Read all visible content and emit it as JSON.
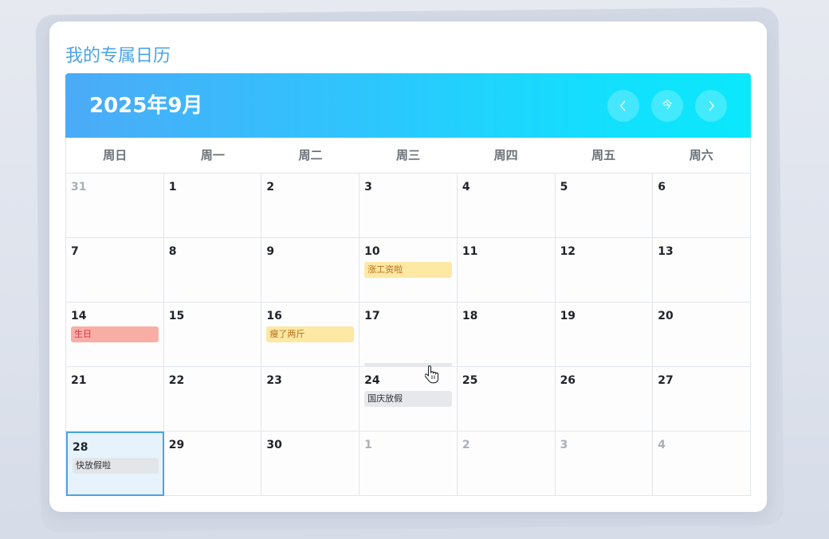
{
  "app": {
    "title": "我的专属日历"
  },
  "header": {
    "month_label": "2025年9月",
    "prev_button": "‹",
    "today_button": "今",
    "next_button": "›"
  },
  "weekdays": [
    "周日",
    "周一",
    "周二",
    "周三",
    "周四",
    "周五",
    "周六"
  ],
  "weeks": [
    [
      {
        "day": "31",
        "other_month": true
      },
      {
        "day": "1"
      },
      {
        "day": "2"
      },
      {
        "day": "3"
      },
      {
        "day": "4"
      },
      {
        "day": "5"
      },
      {
        "day": "6"
      }
    ],
    [
      {
        "day": "7"
      },
      {
        "day": "8"
      },
      {
        "day": "9"
      },
      {
        "day": "10",
        "event": {
          "title": "涨工资啦",
          "color": "yellow"
        }
      },
      {
        "day": "11"
      },
      {
        "day": "12"
      },
      {
        "day": "13"
      }
    ],
    [
      {
        "day": "14",
        "event": {
          "title": "生日",
          "color": "red"
        }
      },
      {
        "day": "15"
      },
      {
        "day": "16",
        "event": {
          "title": "瘦了两斤",
          "color": "yellow"
        }
      },
      {
        "day": "17"
      },
      {
        "day": "18"
      },
      {
        "day": "19"
      },
      {
        "day": "20"
      }
    ],
    [
      {
        "day": "21"
      },
      {
        "day": "22"
      },
      {
        "day": "23"
      },
      {
        "day": "24",
        "event": {
          "title": "国庆放假",
          "color": "gray"
        }
      },
      {
        "day": "25"
      },
      {
        "day": "26"
      },
      {
        "day": "27"
      }
    ],
    [
      {
        "day": "28",
        "selected": true,
        "event": {
          "title": "快放假啦",
          "color": "gray"
        }
      },
      {
        "day": "29"
      },
      {
        "day": "30"
      },
      {
        "day": "1",
        "other_month": true
      },
      {
        "day": "2",
        "other_month": true
      },
      {
        "day": "3",
        "other_month": true
      },
      {
        "day": "4",
        "other_month": true
      }
    ]
  ],
  "colors": {
    "accent": "#4aa3e8",
    "event_yellow": "#fde8a4",
    "event_red": "#f9aea5",
    "event_gray": "#e6e8eb"
  }
}
